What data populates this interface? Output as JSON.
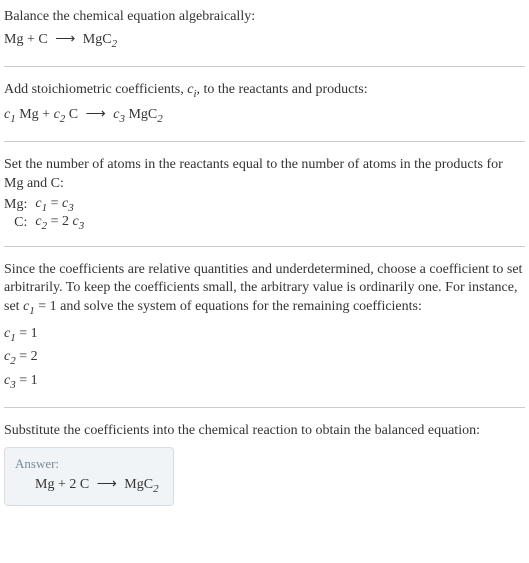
{
  "s1": {
    "intro": "Balance the chemical equation algebraically:",
    "eq_mg": "Mg",
    "eq_plus": " + ",
    "eq_c": "C",
    "eq_arrow": " ⟶ ",
    "eq_mgc": "MgC",
    "eq_mgc_sub": "2"
  },
  "s2": {
    "intro_a": "Add stoichiometric coefficients, ",
    "ci_c": "c",
    "ci_i": "i",
    "intro_b": ", to the reactants and products:",
    "c1": "c",
    "c1s": "1",
    "mg": " Mg",
    "plus": " + ",
    "c2": "c",
    "c2s": "2",
    "cc": " C",
    "arrow": " ⟶ ",
    "c3": "c",
    "c3s": "3",
    "mgc": " MgC",
    "mgc_sub": "2"
  },
  "s3": {
    "intro": "Set the number of atoms in the reactants equal to the number of atoms in the products for Mg and C:",
    "r1_label": "Mg:",
    "r1_lhs_c": "c",
    "r1_lhs_s": "1",
    "r1_eq": " = ",
    "r1_rhs_c": "c",
    "r1_rhs_s": "3",
    "r2_label": "C:",
    "r2_lhs_c": "c",
    "r2_lhs_s": "2",
    "r2_eq": " = 2 ",
    "r2_rhs_c": "c",
    "r2_rhs_s": "3"
  },
  "s4": {
    "intro_a": "Since the coefficients are relative quantities and underdetermined, choose a coefficient to set arbitrarily. To keep the coefficients small, the arbitrary value is ordinarily one. For instance, set ",
    "set_c": "c",
    "set_s": "1",
    "intro_b": " = 1 and solve the system of equations for the remaining coefficients:",
    "l1_c": "c",
    "l1_s": "1",
    "l1_v": " = 1",
    "l2_c": "c",
    "l2_s": "2",
    "l2_v": " = 2",
    "l3_c": "c",
    "l3_s": "3",
    "l3_v": " = 1"
  },
  "s5": {
    "intro": "Substitute the coefficients into the chemical reaction to obtain the balanced equation:",
    "answer_label": "Answer:",
    "eq_mg": "Mg",
    "eq_plus": " + 2 ",
    "eq_c": "C",
    "eq_arrow": " ⟶ ",
    "eq_mgc": "MgC",
    "eq_mgc_sub": "2"
  }
}
